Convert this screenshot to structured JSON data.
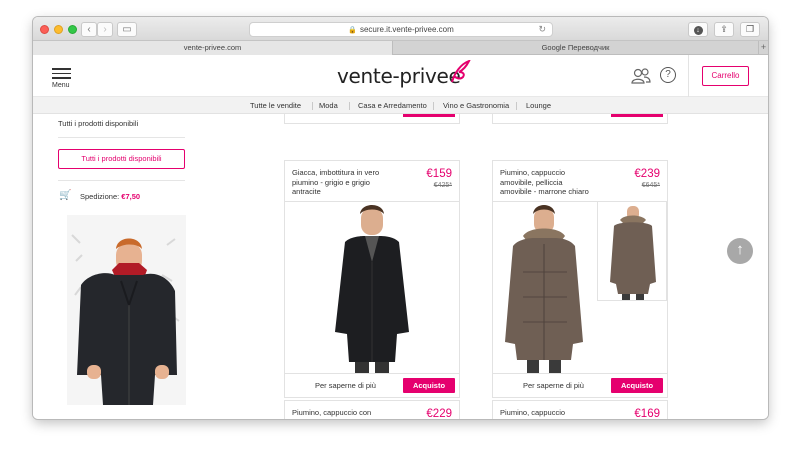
{
  "browser": {
    "url": "secure.it.vente-privee.com",
    "tabs": [
      {
        "label": "vente-privee.com",
        "active": true
      },
      {
        "label": "Google Переводчик",
        "active": false
      }
    ]
  },
  "header": {
    "menu_label": "Menu",
    "logo_text": "vente-privee",
    "cart_label": "Carrello",
    "brand_color": "#e5006e"
  },
  "catnav": {
    "items": [
      "Tutte le vendite",
      "Moda",
      "Casa e Arredamento",
      "Vino e Gastronomia",
      "Lounge"
    ]
  },
  "sidebar": {
    "all_products_text": "Tutti i prodotti disponibili",
    "all_products_button": "Tutti i prodotti disponibili",
    "shipping_label": "Spedizione:",
    "shipping_price": "€7,50"
  },
  "products": {
    "more_label": "Per saperne di più",
    "buy_label": "Acquisto",
    "items": [
      {
        "name": "Giacca, imbottitura in vero piumino - grigio e grigio antracite",
        "price": "€159",
        "old_price": "€425*"
      },
      {
        "name": "Piumino, cappuccio amovibile, pelliccia amovibile - marrone chiaro",
        "price": "€239",
        "old_price": "€645*"
      },
      {
        "name": "Piumino, cappuccio con",
        "price": "€229"
      },
      {
        "name": "Piumino, cappuccio",
        "price": "€169"
      }
    ]
  }
}
